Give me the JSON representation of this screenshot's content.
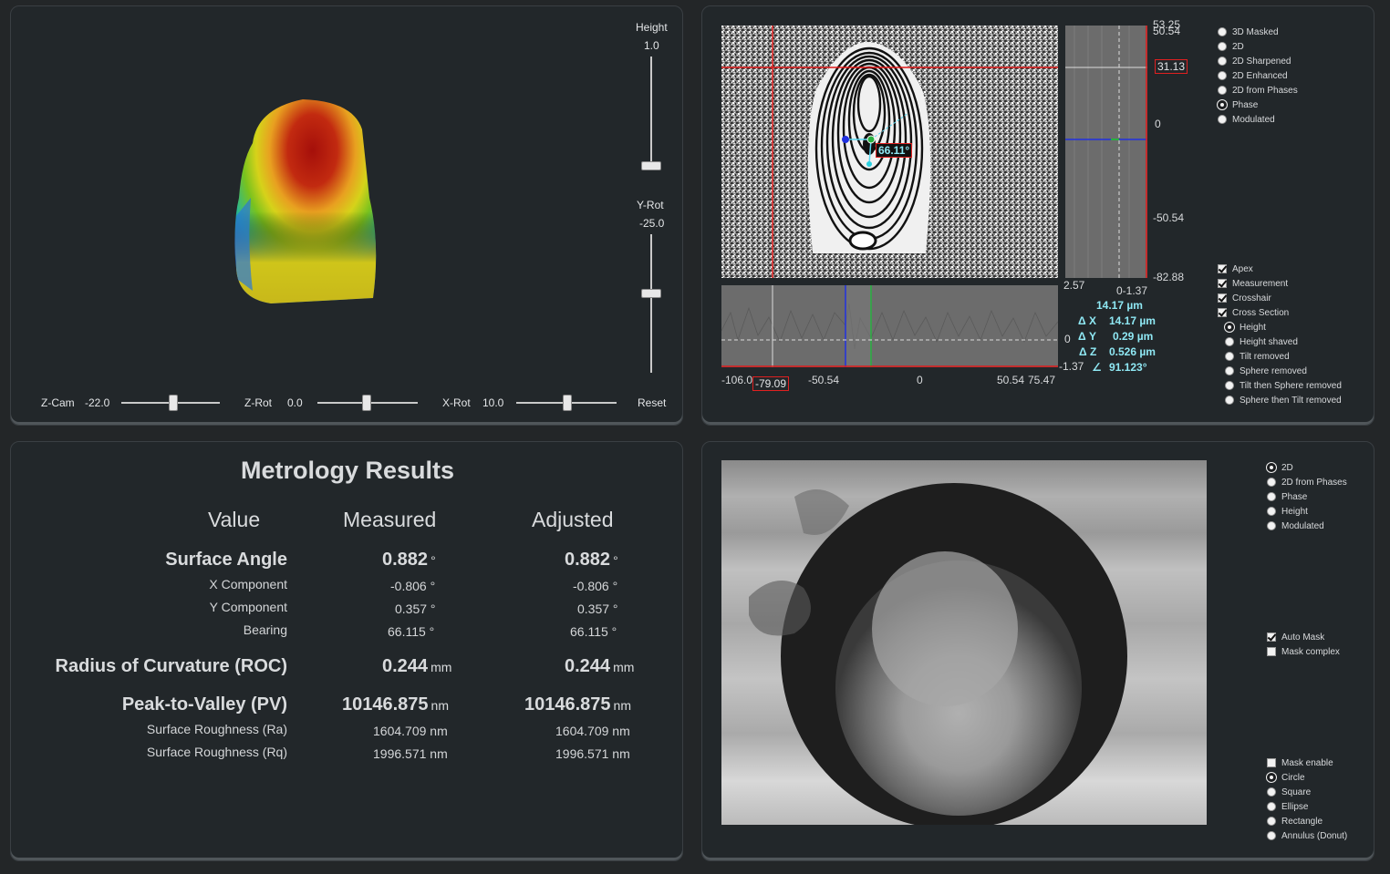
{
  "view3d": {
    "height_label": "Height",
    "height_value": "1.0",
    "yrot_label": "Y-Rot",
    "yrot_value": "-25.0",
    "zcam_label": "Z-Cam",
    "zcam_value": "-22.0",
    "zrot_label": "Z-Rot",
    "zrot_value": "0.0",
    "xrot_label": "X-Rot",
    "xrot_value": "10.0",
    "reset_label": "Reset"
  },
  "phase_view": {
    "angle_label": "66.11°",
    "right_axis": {
      "top1": "53.25",
      "top2": "50.54",
      "marker": "31.13",
      "zero": "0",
      "mid": "-50.54",
      "bottom": "-82.88"
    },
    "right_bottom": {
      "left": "2.57",
      "right": "0-1.37"
    },
    "bottom_axis": {
      "t1": "-106.0",
      "marker": "-79.09",
      "t2": "-50.54",
      "t3": "0",
      "t4": "50.54",
      "t5": "75.47"
    },
    "lower_left_axis": {
      "zero": "0",
      "bottom": "-1.37"
    },
    "measure": {
      "dist": "14.17 µm",
      "dx_label": "Δ X",
      "dx": "14.17 µm",
      "dy_label": "Δ Y",
      "dy": "0.29 µm",
      "dz_label": "Δ Z",
      "dz": "0.526 µm",
      "angle_sym": "∠",
      "angle": "91.123°"
    },
    "view_modes": [
      "3D Masked",
      "2D",
      "2D Sharpened",
      "2D Enhanced",
      "2D from Phases",
      "Phase",
      "Modulated"
    ],
    "view_mode_selected": "Phase",
    "overlays": [
      "Apex",
      "Measurement",
      "Crosshair",
      "Cross Section"
    ],
    "section_modes": [
      "Height",
      "Height shaved",
      "Tilt removed",
      "Sphere removed",
      "Tilt then Sphere removed",
      "Sphere then Tilt removed"
    ],
    "section_selected": "Height"
  },
  "metrology": {
    "title": "Metrology Results",
    "col_value": "Value",
    "col_measured": "Measured",
    "col_adjusted": "Adjusted",
    "surface_angle": {
      "label": "Surface Angle",
      "measured": "0.882",
      "adjusted": "0.882",
      "unit": "°"
    },
    "x_component": {
      "label": "X Component",
      "measured": "-0.806 °",
      "adjusted": "-0.806 °"
    },
    "y_component": {
      "label": "Y Component",
      "measured": "0.357 °",
      "adjusted": "0.357 °"
    },
    "bearing": {
      "label": "Bearing",
      "measured": "66.115 °",
      "adjusted": "66.115 °"
    },
    "roc": {
      "label": "Radius of Curvature (ROC)",
      "measured": "0.244",
      "adjusted": "0.244",
      "unit": "mm"
    },
    "pv": {
      "label": "Peak-to-Valley (PV)",
      "measured": "10146.875",
      "adjusted": "10146.875",
      "unit": "nm"
    },
    "ra": {
      "label": "Surface Roughness (Ra)",
      "measured": "1604.709 nm",
      "adjusted": "1604.709 nm"
    },
    "rq": {
      "label": "Surface Roughness (Rq)",
      "measured": "1996.571 nm",
      "adjusted": "1996.571 nm"
    }
  },
  "camera": {
    "modes": [
      "2D",
      "2D from Phases",
      "Phase",
      "Height",
      "Modulated"
    ],
    "mode_selected": "2D",
    "auto_mask": "Auto Mask",
    "mask_complex": "Mask complex",
    "mask_enable": "Mask enable",
    "shapes": [
      "Circle",
      "Square",
      "Ellipse",
      "Rectangle",
      "Annulus (Donut)"
    ],
    "shape_selected": "Circle"
  }
}
